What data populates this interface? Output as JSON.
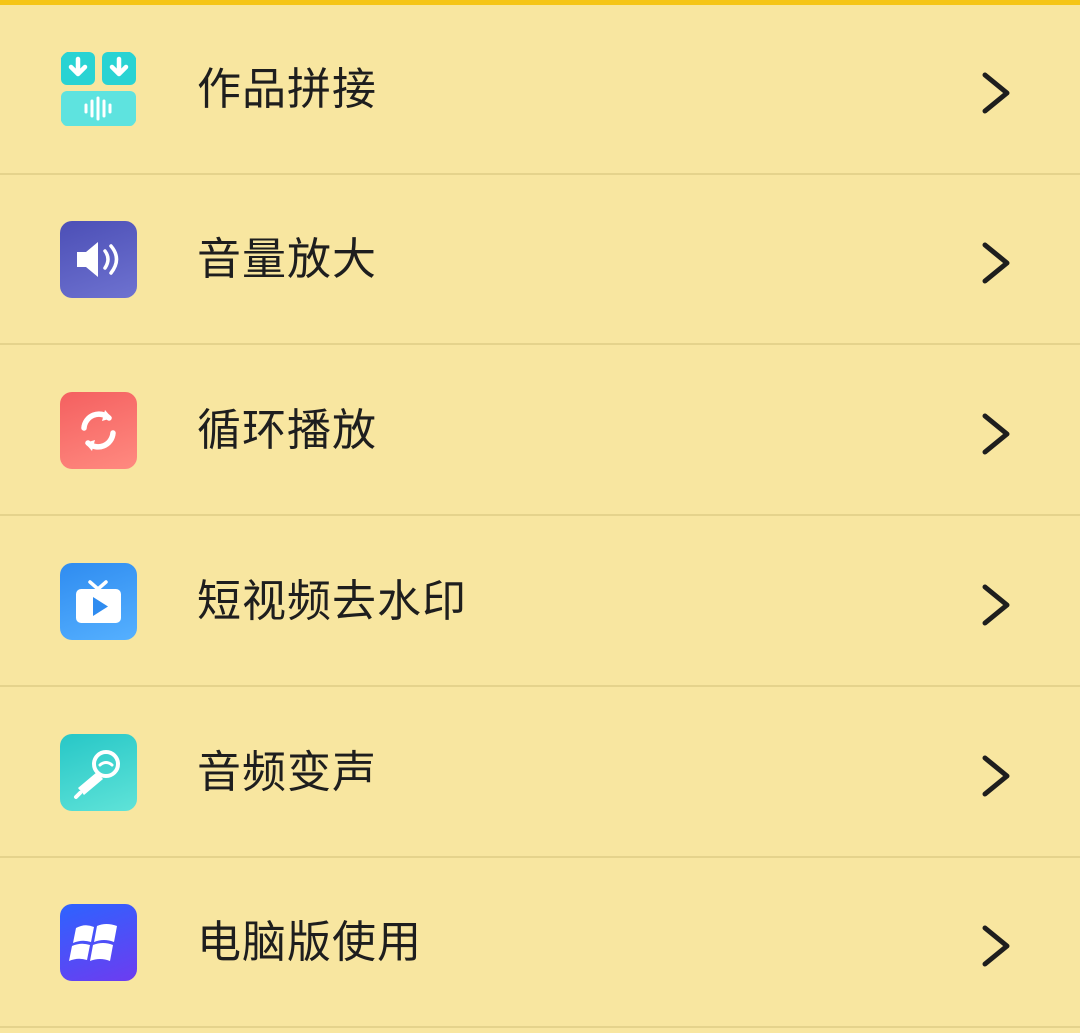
{
  "menu": {
    "items": [
      {
        "label": "作品拼接",
        "icon": "merge-works-icon"
      },
      {
        "label": "音量放大",
        "icon": "volume-up-icon"
      },
      {
        "label": "循环播放",
        "icon": "loop-play-icon"
      },
      {
        "label": "短视频去水印",
        "icon": "tv-play-icon"
      },
      {
        "label": "音频变声",
        "icon": "voice-change-icon"
      },
      {
        "label": "电脑版使用",
        "icon": "windows-logo-icon"
      }
    ],
    "chevron_icon": "chevron-right-icon"
  },
  "colors": {
    "background": "#f8e6a0",
    "top_accent": "#f5c518",
    "divider": "#e5d38c",
    "text": "#1e1e1e"
  }
}
